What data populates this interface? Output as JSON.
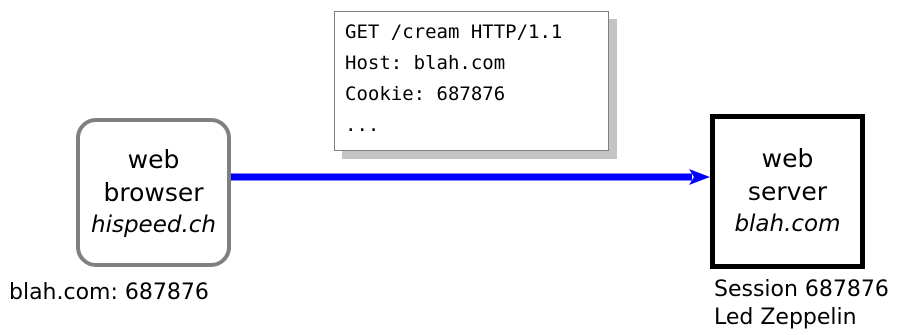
{
  "request": {
    "lines": [
      "GET /cream HTTP/1.1",
      "Host: blah.com",
      "Cookie: 687876",
      "..."
    ]
  },
  "browser": {
    "line1": "web",
    "line2": "browser",
    "host": "hispeed.ch",
    "caption": "blah.com: 687876"
  },
  "server": {
    "line1": "web",
    "line2": "server",
    "host": "blah.com",
    "caption_lines": [
      "Session 687876",
      "Led Zeppelin"
    ]
  },
  "colors": {
    "arrow": "#0000ff",
    "browser_border": "#808080",
    "server_border": "#000000"
  }
}
